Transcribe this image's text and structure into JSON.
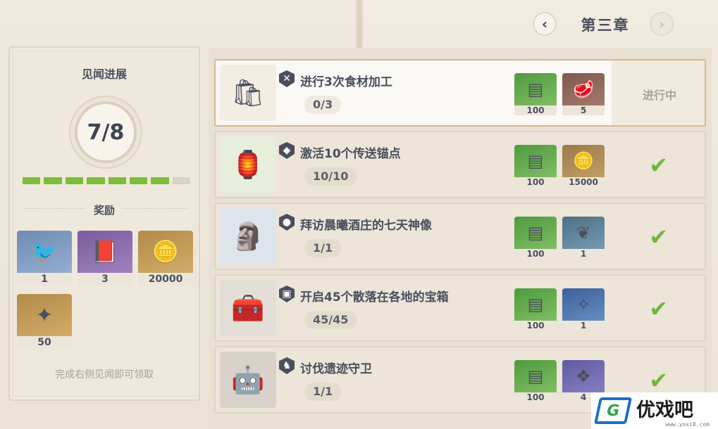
{
  "chapter": {
    "title": "第三章"
  },
  "progress_panel": {
    "title": "见闻进展",
    "progress_text": "7/8",
    "progress_completed": 7,
    "progress_total": 8,
    "rewards_label": "奖励",
    "rewards": [
      {
        "icon": "blue-bird-icon",
        "count": "1"
      },
      {
        "icon": "purple-book-icon",
        "count": "3"
      },
      {
        "icon": "mora-coin-icon",
        "count": "20000"
      },
      {
        "icon": "primogem-icon",
        "count": "50"
      }
    ],
    "hint": "完成右侧见闻即可领取"
  },
  "quests": [
    {
      "title": "进行3次食材加工",
      "progress": "0/3",
      "type_icon": "cooking-icon",
      "art_icon": "flour-sack-icon",
      "status": "进行中",
      "completed": false,
      "rewards": [
        {
          "icon": "adventure-exp-icon",
          "count": "100"
        },
        {
          "icon": "raw-meat-icon",
          "count": "5"
        }
      ]
    },
    {
      "title": "激活10个传送锚点",
      "progress": "10/10",
      "type_icon": "waypoint-icon",
      "art_icon": "teleport-waypoint-icon",
      "status": "",
      "completed": true,
      "rewards": [
        {
          "icon": "adventure-exp-icon",
          "count": "100"
        },
        {
          "icon": "mora-coin-icon",
          "count": "15000"
        }
      ]
    },
    {
      "title": "拜访晨曦酒庄的七天神像",
      "progress": "1/1",
      "type_icon": "statue-icon",
      "art_icon": "statue-of-seven-icon",
      "status": "",
      "completed": true,
      "rewards": [
        {
          "icon": "adventure-exp-icon",
          "count": "100"
        },
        {
          "icon": "laurel-wreath-icon",
          "count": "1"
        }
      ]
    },
    {
      "title": "开启45个散落在各地的宝箱",
      "progress": "45/45",
      "type_icon": "chest-icon",
      "art_icon": "treasure-chest-icon",
      "status": "",
      "completed": true,
      "rewards": [
        {
          "icon": "adventure-exp-icon",
          "count": "100"
        },
        {
          "icon": "crystal-shard-icon",
          "count": "1"
        }
      ]
    },
    {
      "title": "讨伐遗迹守卫",
      "progress": "1/1",
      "type_icon": "combat-icon",
      "art_icon": "ruin-guard-icon",
      "status": "",
      "completed": true,
      "rewards": [
        {
          "icon": "adventure-exp-icon",
          "count": "100"
        },
        {
          "icon": "crystal-chunk-icon",
          "count": "4"
        }
      ]
    }
  ],
  "watermark": {
    "text": "优戏吧",
    "sub": "www.yoxi8.com"
  }
}
